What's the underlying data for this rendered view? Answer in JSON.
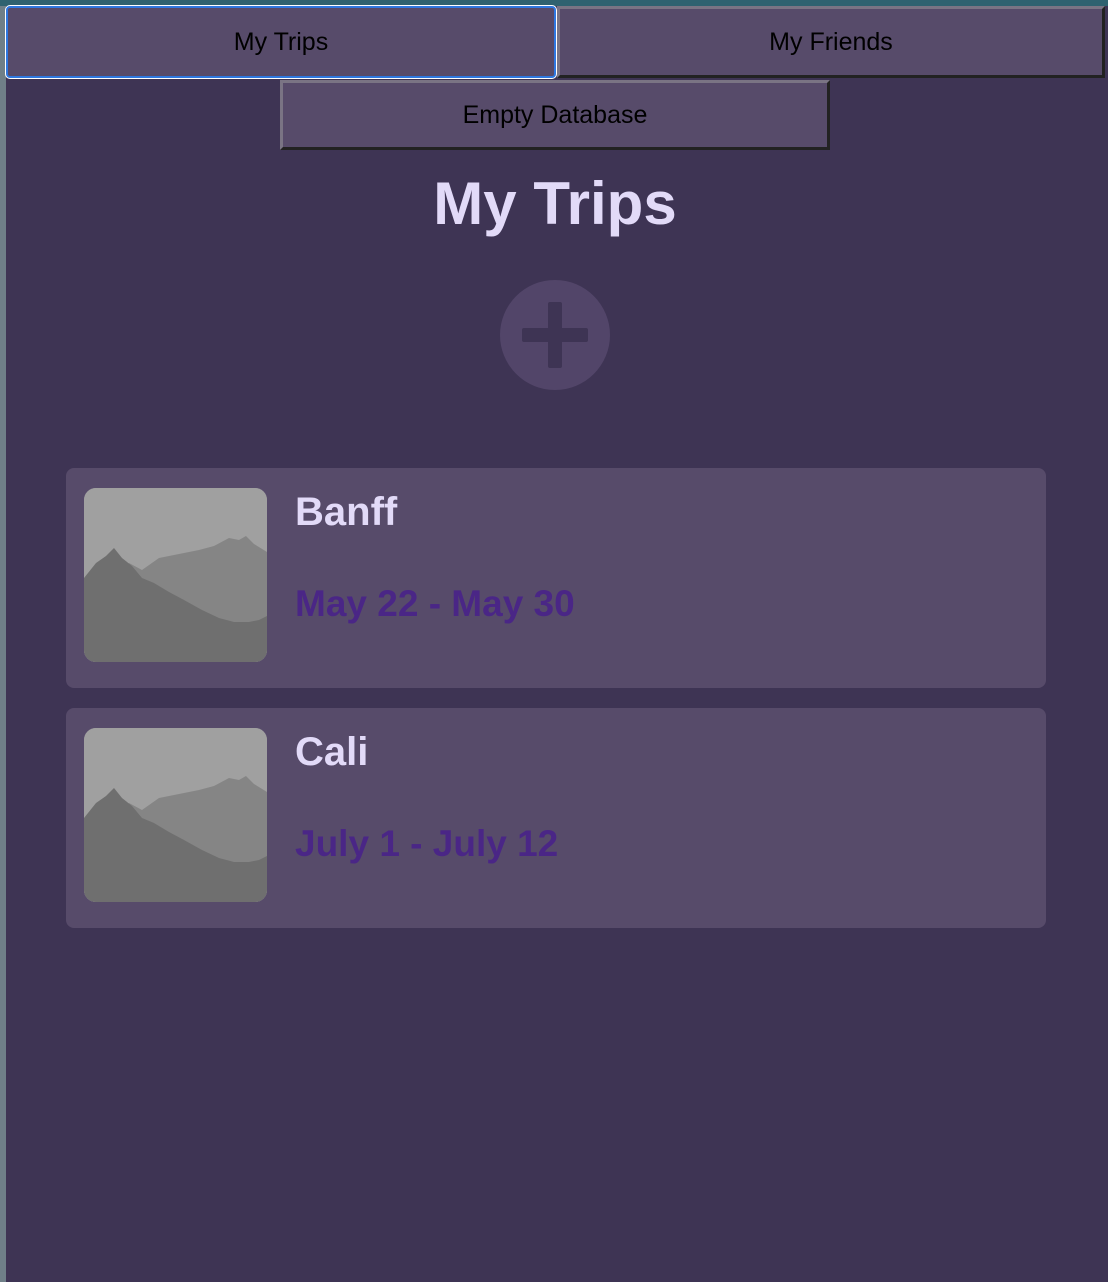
{
  "nav": {
    "tabs": [
      {
        "label": "My Trips"
      },
      {
        "label": "My Friends"
      }
    ],
    "empty_db_label": "Empty Database"
  },
  "main": {
    "title": "My Trips",
    "add_icon": "plus-circle-icon",
    "trips": [
      {
        "name": "Banff",
        "dates": "May 22 - May 30",
        "thumbnail": "mountain-placeholder-icon"
      },
      {
        "name": "Cali",
        "dates": "July 1 - July 12",
        "thumbnail": "mountain-placeholder-icon"
      }
    ]
  },
  "colors": {
    "background": "#3e3454",
    "card": "#574b6a",
    "title_text": "#e2daf8",
    "date_text": "#4a2686",
    "focus_ring": "#2f78e0"
  }
}
